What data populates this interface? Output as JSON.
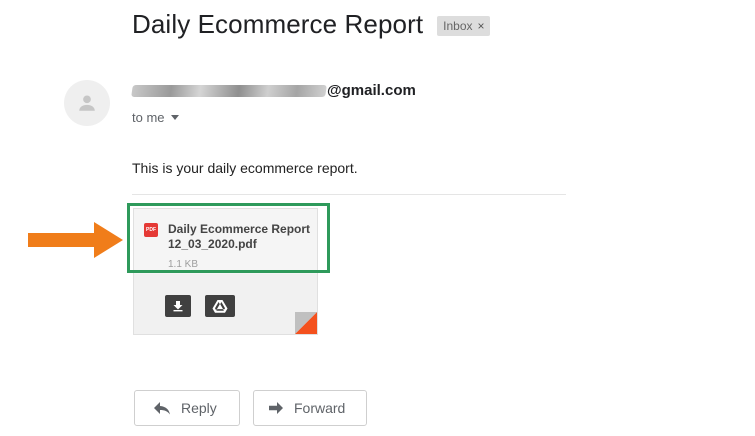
{
  "email": {
    "subject": "Daily Ecommerce Report",
    "label": "Inbox",
    "label_remove": "×",
    "sender_visible": "@gmail.com",
    "recipient": "to me",
    "body": "This is your daily ecommerce report."
  },
  "attachment": {
    "badge": "PDF",
    "filename": "Daily Ecommerce Report 12_03_2020.pdf",
    "size": "1.1 KB"
  },
  "actions": {
    "reply_label": "Reply",
    "forward_label": "Forward"
  },
  "colors": {
    "highlight": "#2e9a5b",
    "arrow": "#f07d1a",
    "pdf_red": "#e53935"
  },
  "icons": {
    "avatar": "person-icon",
    "download": "download-icon",
    "drive": "google-drive-icon",
    "reply": "reply-icon",
    "forward": "forward-icon"
  }
}
